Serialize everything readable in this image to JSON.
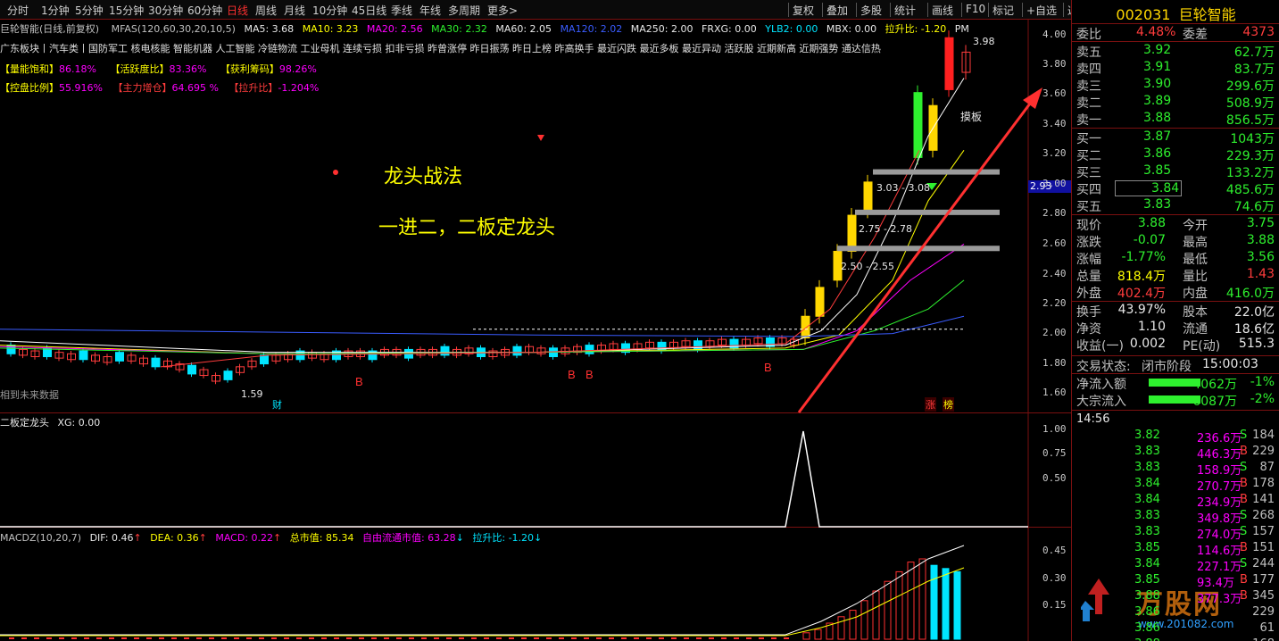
{
  "toolbar": {
    "periods": [
      "分时",
      "1分钟",
      "5分钟",
      "15分钟",
      "30分钟",
      "60分钟",
      "日线",
      "周线",
      "月线",
      "10分钟",
      "45日线",
      "季线",
      "年线",
      "多周期",
      "更多>"
    ],
    "active_period": "日线",
    "right_buttons": [
      "复权",
      "叠加",
      "多股",
      "统计",
      "画线",
      "F10",
      "标记",
      "+自选",
      "返回"
    ]
  },
  "chart": {
    "title": "巨轮智能(日线,前复权)",
    "ma_label": "MFAS(120,60,30,20,10,5)",
    "ma5": "MA5: 3.68",
    "ma10": "MA10: 3.23",
    "ma20": "MA20: 2.56",
    "ma30": "MA30: 2.32",
    "ma60": "MA60: 2.05",
    "ma120": "MA120: 2.02",
    "ma250": "MA250: 2.00",
    "frxg": "FRXG: 0.00",
    "ylb2": "YLB2: 0.00",
    "mbx": "MBX: 0.00",
    "lsb": "拉升比: -1.20",
    "pm": "PM",
    "sectors": "广东板块丨汽车类丨国防军工 核电核能 智能机器 人工智能 冷链物流 工业母机 连续亏损 扣非亏损 昨曾涨停 昨日振荡 昨日上榜 昨高换手 最近闪跌 最近多板 最近异动 活跃股 近期新高 近期强势 通达信热",
    "ind_row1": [
      "【量能饱和】",
      "86.18%",
      "【活跃度比】",
      "83.36%",
      "【获利筹码】",
      "98.26%"
    ],
    "ind_row2": [
      "【控盘比例】",
      "55.916%",
      "【主力增仓】",
      "64.695 %",
      "【拉升比】",
      "-1.204%"
    ],
    "annot_title": "龙头战法",
    "annot_sub": "一进二，二板定龙头",
    "range1": "2.50 - 2.55",
    "range2": "2.75 - 2.78",
    "range3": "3.03 - 3.08",
    "mopan": "摸板",
    "peak": "3.98",
    "low_lbl": "1.59",
    "future_lbl": "相到未来数据",
    "cai": "财",
    "zhang": "涨",
    "bang": "榜",
    "price_tag": "2.93",
    "y_axis": [
      "4.00",
      "3.80",
      "3.60",
      "3.40",
      "3.20",
      "3.00",
      "2.80",
      "2.60",
      "2.40",
      "2.20",
      "2.00",
      "1.80",
      "1.60"
    ]
  },
  "sub1": {
    "title": "二板定龙头",
    "xg": "XG: 0.00",
    "y_axis": [
      "1.00",
      "0.75",
      "0.50"
    ]
  },
  "sub2": {
    "title": "MACDZ(10,20,7)",
    "dif": "DIF: 0.46",
    "dea": "DEA: 0.36",
    "macd": "MACD: 0.22",
    "zsz": "总市值: 85.34",
    "ltsz": "自由流通市值: 63.28",
    "lsb": "拉升比: -1.20",
    "y_axis": [
      "0.45",
      "0.30",
      "0.15"
    ]
  },
  "quote": {
    "code": "002031",
    "name": "巨轮智能",
    "weibi_label": "委比",
    "weibi": "4.48%",
    "weicha_label": "委差",
    "weicha": "4373",
    "sells": [
      {
        "label": "卖五",
        "price": "3.92",
        "vol": "62.7万"
      },
      {
        "label": "卖四",
        "price": "3.91",
        "vol": "83.7万"
      },
      {
        "label": "卖三",
        "price": "3.90",
        "vol": "299.6万"
      },
      {
        "label": "卖二",
        "price": "3.89",
        "vol": "508.9万"
      },
      {
        "label": "卖一",
        "price": "3.88",
        "vol": "856.5万"
      }
    ],
    "buys": [
      {
        "label": "买一",
        "price": "3.87",
        "vol": "1043万"
      },
      {
        "label": "买二",
        "price": "3.86",
        "vol": "229.3万"
      },
      {
        "label": "买三",
        "price": "3.85",
        "vol": "133.2万"
      },
      {
        "label": "买四",
        "price": "3.84",
        "vol": "485.6万"
      },
      {
        "label": "买五",
        "price": "3.83",
        "vol": "74.6万"
      }
    ],
    "stats": [
      {
        "l1": "现价",
        "v1": "3.88",
        "c1": "green",
        "l2": "今开",
        "v2": "3.75",
        "c2": "green"
      },
      {
        "l1": "涨跌",
        "v1": "-0.07",
        "c1": "green",
        "l2": "最高",
        "v2": "3.88",
        "c2": "green"
      },
      {
        "l1": "涨幅",
        "v1": "-1.77%",
        "c1": "green",
        "l2": "最低",
        "v2": "3.56",
        "c2": "green"
      },
      {
        "l1": "总量",
        "v1": "818.4万",
        "c1": "yellow",
        "l2": "量比",
        "v2": "1.43",
        "c2": "red"
      },
      {
        "l1": "外盘",
        "v1": "402.4万",
        "c1": "red",
        "l2": "内盘",
        "v2": "416.0万",
        "c2": "green"
      }
    ],
    "stats2": [
      {
        "l1": "换手",
        "v1": "43.97%",
        "l2": "股本",
        "v2": "22.0亿"
      },
      {
        "l1": "净资",
        "v1": "1.10",
        "l2": "流通",
        "v2": "18.6亿"
      },
      {
        "l1": "收益(一)",
        "v1": "0.002",
        "l2": "PE(动)",
        "v2": "515.3"
      }
    ],
    "status_label": "交易状态:",
    "status": "闭市阶段",
    "status_time": "15:00:03",
    "flow": [
      {
        "label": "净流入额",
        "val": "-4062万",
        "pct": "-1%"
      },
      {
        "label": "大宗流入",
        "val": "-6087万",
        "pct": "-2%"
      }
    ],
    "ticks_time": "14:56",
    "ticks": [
      {
        "p": "3.82",
        "v": "236.6万",
        "s": "S",
        "n": "184"
      },
      {
        "p": "3.83",
        "v": "446.3万",
        "s": "B",
        "n": "229"
      },
      {
        "p": "3.83",
        "v": "158.9万",
        "s": "S",
        "n": "87"
      },
      {
        "p": "3.84",
        "v": "270.7万",
        "s": "B",
        "n": "178"
      },
      {
        "p": "3.84",
        "v": "234.9万",
        "s": "B",
        "n": "141"
      },
      {
        "p": "3.83",
        "v": "349.8万",
        "s": "S",
        "n": "268"
      },
      {
        "p": "3.83",
        "v": "274.0万",
        "s": "S",
        "n": "157"
      },
      {
        "p": "3.85",
        "v": "114.6万",
        "s": "B",
        "n": "151"
      },
      {
        "p": "3.84",
        "v": "227.1万",
        "s": "S",
        "n": "244"
      },
      {
        "p": "3.85",
        "v": "93.4万",
        "s": "B",
        "n": "177"
      },
      {
        "p": "3.88",
        "v": "377.3万",
        "s": "B",
        "n": "345"
      },
      {
        "p": "3.86",
        "v": "",
        "s": "",
        "n": "229"
      },
      {
        "p": "3.86",
        "v": "",
        "s": "",
        "n": "61"
      },
      {
        "p": "3.88",
        "v": "",
        "s": "",
        "n": "168"
      }
    ],
    "watermark": "万股网",
    "watermark_url": "www.201082.com"
  }
}
